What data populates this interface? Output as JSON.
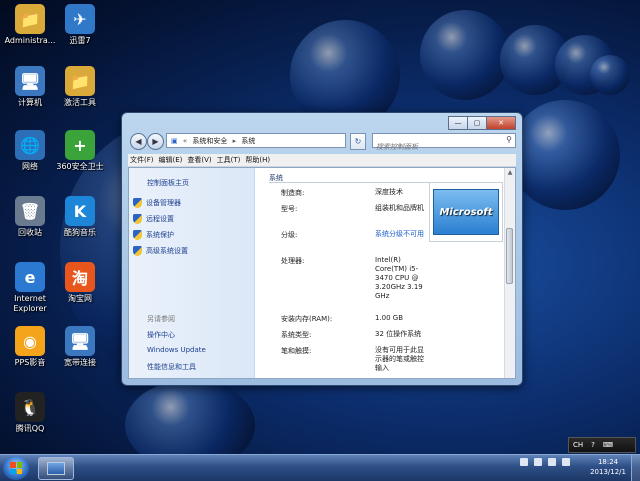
{
  "desktop": {
    "icons": [
      {
        "label": "Administra...",
        "glyph": "📁",
        "color": "#d9a93a"
      },
      {
        "label": "迅雷7",
        "glyph": "✈",
        "color": "#2f79c8"
      },
      {
        "label": "计算机",
        "glyph": "🖥",
        "color": "#3b78c0"
      },
      {
        "label": "激活工具",
        "glyph": "📁",
        "color": "#d9a93a"
      },
      {
        "label": "网络",
        "glyph": "🌐",
        "color": "#2d6fb7"
      },
      {
        "label": "360安全卫士",
        "glyph": "+",
        "color": "#3aa43a"
      },
      {
        "label": "回收站",
        "glyph": "🗑",
        "color": "#6b7b8f"
      },
      {
        "label": "酷狗音乐",
        "glyph": "K",
        "color": "#1d86d8"
      },
      {
        "label": "Internet Explorer",
        "glyph": "e",
        "color": "#2b79d1"
      },
      {
        "label": "淘宝网",
        "glyph": "淘",
        "color": "#e8561e"
      },
      {
        "label": "PPS影音",
        "glyph": "◉",
        "color": "#f3a41a"
      },
      {
        "label": "宽带连接",
        "glyph": "🖥",
        "color": "#3b78c0"
      },
      {
        "label": "腾讯QQ",
        "glyph": "🐧",
        "color": "#222222"
      }
    ]
  },
  "window": {
    "address": {
      "part1": "系统和安全",
      "part2": "系统"
    },
    "search_placeholder": "搜索控制面板",
    "controls": {
      "min": "—",
      "max": "▢",
      "close": "✕"
    },
    "menu": [
      "文件(F)",
      "编辑(E)",
      "查看(V)",
      "工具(T)",
      "帮助(H)"
    ],
    "sidebar": {
      "home": "控制面板主页",
      "items": [
        "设备管理器",
        "远程设置",
        "系统保护",
        "高级系统设置"
      ],
      "see_also": "另请参阅",
      "links": [
        "操作中心",
        "Windows Update",
        "性能信息和工具"
      ]
    },
    "main": {
      "section_title": "系统",
      "rows": [
        {
          "label": "制造商:",
          "value": "深度技术",
          "link": false
        },
        {
          "label": "型号:",
          "value": "组装机和品牌机",
          "link": false
        },
        {
          "label": "分级:",
          "value": "系统分级不可用",
          "link": true
        },
        {
          "label": "处理器:",
          "value": "Intel(R) Core(TM) i5-3470 CPU @ 3.20GHz 3.19 GHz",
          "link": false
        },
        {
          "label": "安装内存(RAM):",
          "value": "1.00 GB",
          "link": false
        },
        {
          "label": "系统类型:",
          "value": "32 位操作系统",
          "link": false
        },
        {
          "label": "笔和触摸:",
          "value": "没有可用于此显示器的笔或触控输入",
          "link": false
        }
      ],
      "logo_text": "Microsoft"
    }
  },
  "taskbar": {
    "time": "18:24",
    "date": "2013/12/1",
    "lang": "CH"
  }
}
